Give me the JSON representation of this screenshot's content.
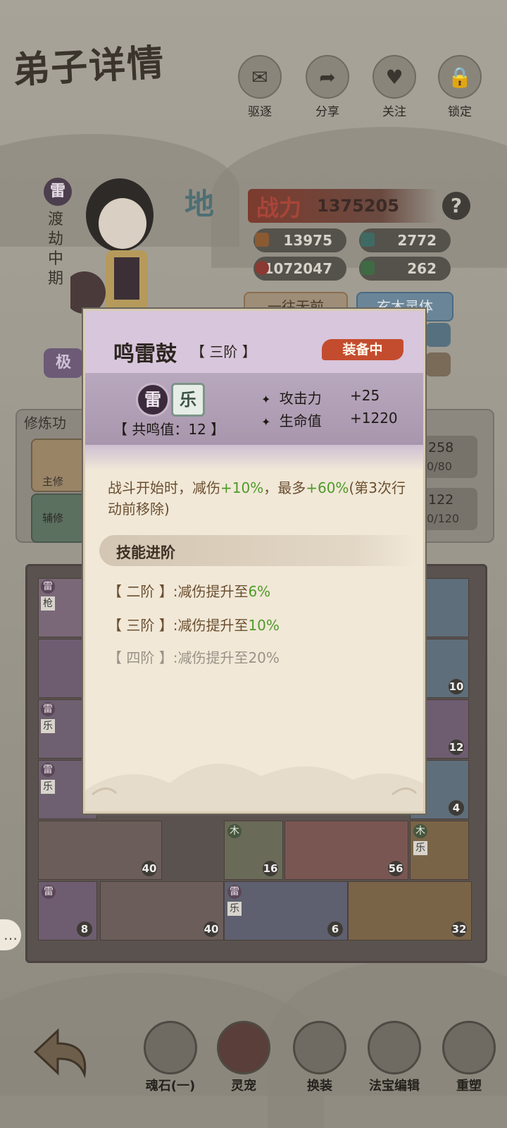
{
  "page": {
    "title": "弟子详情"
  },
  "top_actions": [
    {
      "label": "驱逐",
      "icon": "scroll-icon"
    },
    {
      "label": "分享",
      "icon": "share-arrow-icon"
    },
    {
      "label": "关注",
      "icon": "heart-icon"
    },
    {
      "label": "锁定",
      "icon": "lock-icon"
    }
  ],
  "disciple": {
    "element": "雷",
    "realm": "渡劫中期",
    "grade": "地",
    "power_label": "战力",
    "power": "1375205",
    "attack": "13975",
    "defense": "2772",
    "hp": "1072047",
    "speed": "262",
    "trait_1": "一往无前",
    "trait_2": "玄木灵体",
    "tag_left": "极"
  },
  "cultivation": {
    "label": "修炼功",
    "main_label": "主修",
    "aux_label": "辅修",
    "main_value": "258",
    "main_sub": "0/80",
    "aux_value": "122",
    "aux_sub": "0/120"
  },
  "inventory_counts": [
    "10",
    "12",
    "4",
    "40",
    "16",
    "56",
    "8",
    "40",
    "6",
    "32"
  ],
  "inventory_tags": {
    "thunder": "雷",
    "spear": "枪",
    "music": "乐",
    "wood": "木"
  },
  "bottom_nav": [
    {
      "label": "魂石(一)",
      "icon": "soul-stone-icon"
    },
    {
      "label": "灵宠",
      "icon": "pet-icon"
    },
    {
      "label": "换装",
      "icon": "outfit-icon"
    },
    {
      "label": "法宝编辑",
      "icon": "treasure-icon"
    },
    {
      "label": "重塑",
      "icon": "reshape-icon"
    }
  ],
  "modal": {
    "name": "鸣雷鼓",
    "tier": "【 三阶 】",
    "status": "装备中",
    "elements": [
      "雷",
      "乐"
    ],
    "resonance": "【 共鸣值：12 】",
    "attrs": [
      {
        "name": "攻击力",
        "value": "+25"
      },
      {
        "name": "生命值",
        "value": "+1220"
      }
    ],
    "desc_a": "战斗开始时，减伤",
    "desc_b": "+10%",
    "desc_c": "，最多",
    "desc_d": "+60%",
    "desc_e": "(第3次行动前移除)",
    "skill_header": "技能进阶",
    "skill_tiers": [
      {
        "label": "【 二阶 】:减伤提升至",
        "value": "6%",
        "active": true
      },
      {
        "label": "【 三阶 】:减伤提升至",
        "value": "10%",
        "active": true
      },
      {
        "label": "【 四阶 】:减伤提升至",
        "value": "20%",
        "active": false
      }
    ]
  },
  "colors": {
    "equip_badge": "#c44c2e",
    "bonus_green": "#4e9a2a",
    "modal_header": "#d8c6dc"
  }
}
